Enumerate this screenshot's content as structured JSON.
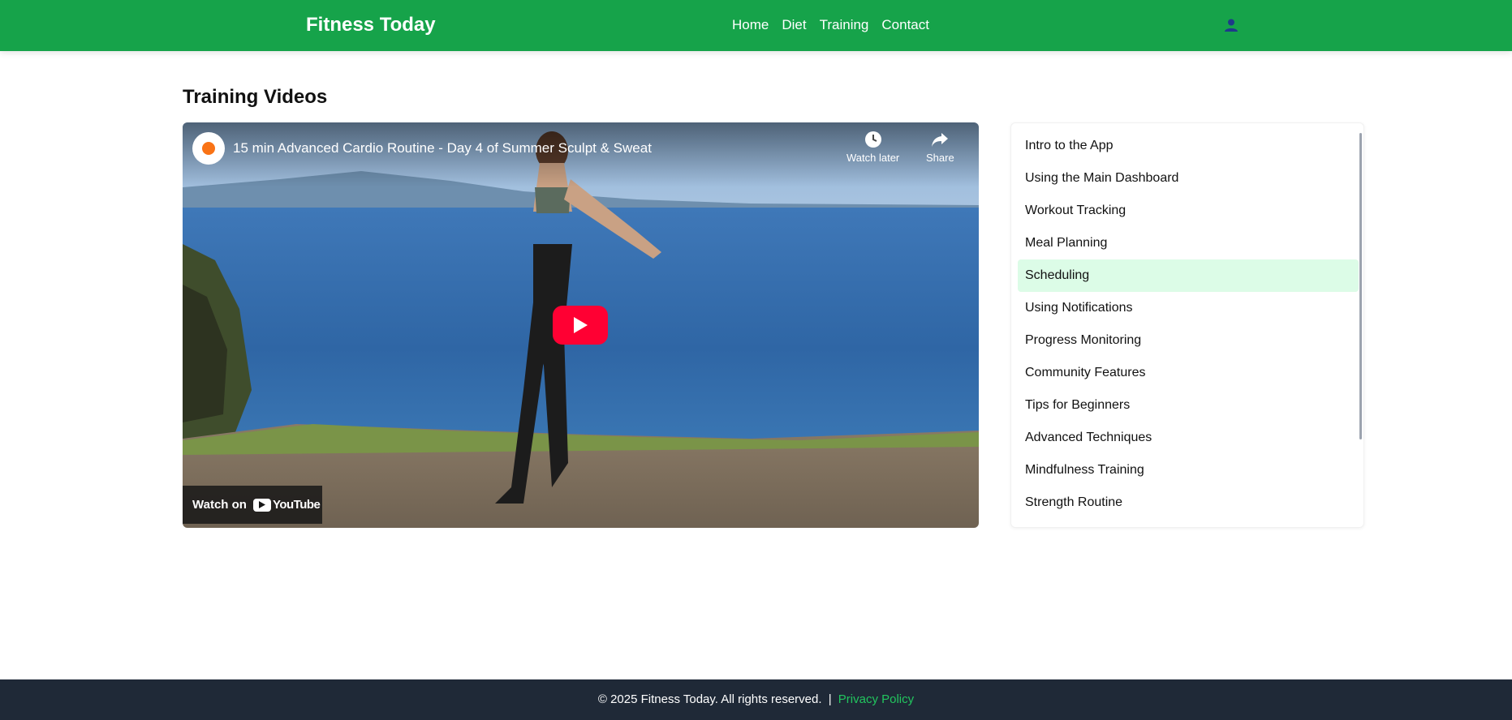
{
  "header": {
    "brand": "Fitness Today",
    "nav": [
      "Home",
      "Diet",
      "Training",
      "Contact"
    ],
    "user_icon": "user-icon",
    "color": "#16a34a"
  },
  "main": {
    "title": "Training Videos",
    "video": {
      "title": "15 min Advanced Cardio Routine - Day 4 of Summer Sculpt & Sweat",
      "watch_later": "Watch later",
      "share": "Share",
      "watch_on": "Watch on",
      "youtube": "YouTube",
      "play_color": "#ff0033"
    },
    "playlist": {
      "items": [
        "Intro to the App",
        "Using the Main Dashboard",
        "Workout Tracking",
        "Meal Planning",
        "Scheduling",
        "Using Notifications",
        "Progress Monitoring",
        "Community Features",
        "Tips for Beginners",
        "Advanced Techniques",
        "Mindfulness Training",
        "Strength Routine"
      ],
      "active": "Scheduling",
      "active_color": "#dcfce7"
    }
  },
  "footer": {
    "copyright": "© 2025 Fitness Today. All rights reserved.",
    "separator": "|",
    "privacy": "Privacy Policy",
    "link_color": "#22c55e"
  }
}
